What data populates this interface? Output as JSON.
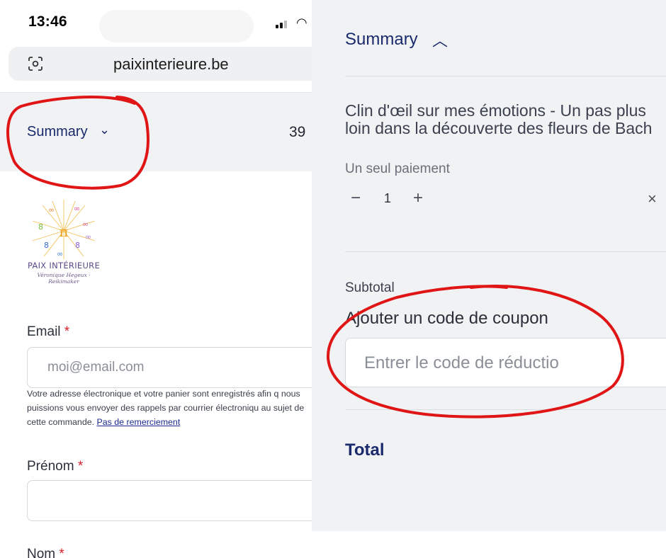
{
  "status_bar": {
    "time": "13:46"
  },
  "browser": {
    "url": "paixinterieure.be"
  },
  "order_summary_collapsed": {
    "label": "Summary",
    "amount_visible": "39"
  },
  "logo": {
    "title": "PAIX INTÉRIEURE",
    "signature": "Véronique Hegeux · Reikimaker"
  },
  "form": {
    "email": {
      "label": "Email",
      "required_mark": "*",
      "placeholder": "moi@email.com"
    },
    "helper": {
      "text": "Votre adresse électronique et votre panier sont enregistrés afin q nous puissions vous envoyer des rappels par courrier électroniqu au sujet de cette commande.",
      "link": "Pas de remerciement"
    },
    "first_name": {
      "label": "Prénom",
      "required_mark": "*"
    },
    "last_name": {
      "label": "Nom",
      "required_mark": "*"
    }
  },
  "order_summary_expanded": {
    "label": "Summary",
    "product": {
      "name": "Clin d'œil sur mes émotions - Un pas plus loin dans la découverte des fleurs de Bach",
      "plan": "Un seul paiement",
      "quantity": "1",
      "minus": "−",
      "plus": "+",
      "remove": "×"
    },
    "subtotal_label": "Subtotal",
    "coupon": {
      "label": "Ajouter un code de coupon",
      "placeholder": "Entrer le code de réductio"
    },
    "total_label": "Total"
  },
  "colors": {
    "accent": "#1a2a6c",
    "panel_bg": "#f1f2f4",
    "annotation": "#e01515",
    "required": "#d6202c"
  }
}
